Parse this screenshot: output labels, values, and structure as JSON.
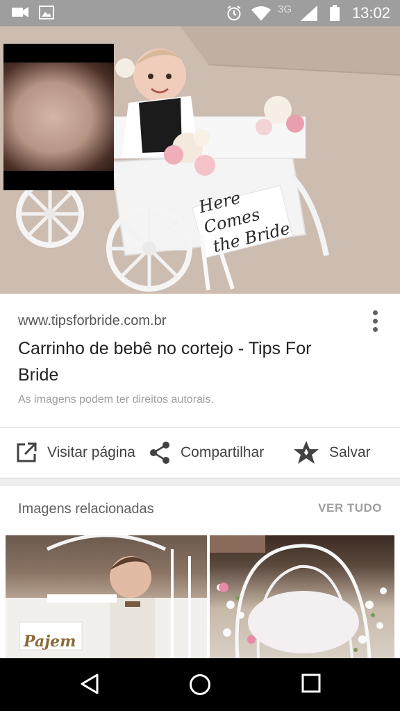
{
  "status_bar": {
    "time": "13:02",
    "network": "3G",
    "icons": [
      "video-camera-icon",
      "image-icon",
      "alarm-icon",
      "wifi-icon",
      "signal-icon",
      "battery-icon"
    ]
  },
  "hero": {
    "sign_text_line1": "Here Comes",
    "sign_text_line2": "the Bride"
  },
  "result": {
    "domain": "www.tipsforbride.com.br",
    "title": "Carrinho de bebê no cortejo - Tips For Bride",
    "rights_notice": "As imagens podem ter direitos autorais."
  },
  "actions": {
    "visit_label": "Visitar página",
    "share_label": "Compartilhar",
    "save_label": "Salvar"
  },
  "related": {
    "title": "Imagens relacionadas",
    "see_all_label": "VER TUDO",
    "image_a_caption": "Pajem"
  },
  "colors": {
    "status_bar": "#9e9e9e",
    "card_bg": "#ffffff",
    "page_bg": "#eeeeee",
    "nav_bar": "#000000"
  }
}
